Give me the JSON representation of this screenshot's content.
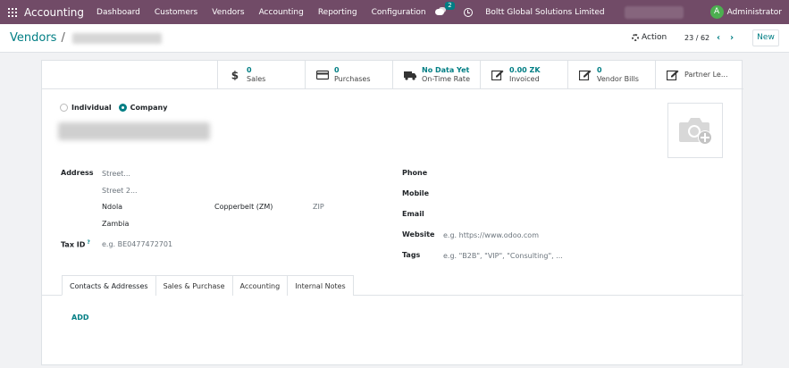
{
  "navbar": {
    "app_name": "Accounting",
    "menu": [
      "Dashboard",
      "Customers",
      "Vendors",
      "Accounting",
      "Reporting",
      "Configuration"
    ],
    "chat_count": "2",
    "company": "Boltt Global Solutions Limited",
    "avatar_letter": "A",
    "user": "Administrator"
  },
  "control": {
    "breadcrumb_parent": "Vendors",
    "breadcrumb_sep": "/",
    "action_label": "Action",
    "pager": "23 / 62",
    "new_label": "New"
  },
  "stats": [
    {
      "value": "0",
      "label": "Sales",
      "icon": "dollar-icon"
    },
    {
      "value": "0",
      "label": "Purchases",
      "icon": "credit-card-icon"
    },
    {
      "value": "No Data Yet",
      "label": "On-Time Rate",
      "icon": "truck-icon"
    },
    {
      "value": "0.00 ZK",
      "label": "Invoiced",
      "icon": "edit-icon"
    },
    {
      "value": "0",
      "label": "Vendor Bills",
      "icon": "edit-icon"
    },
    {
      "value": "",
      "label": "Partner Le...",
      "icon": "edit-icon"
    }
  ],
  "company_type": {
    "individual": "Individual",
    "company": "Company",
    "selected": "Company"
  },
  "fields": {
    "address_label": "Address",
    "street_placeholder": "Street...",
    "street2_placeholder": "Street 2...",
    "city": "Ndola",
    "state": "Copperbelt (ZM)",
    "zip_placeholder": "ZIP",
    "country": "Zambia",
    "tax_label": "Tax ID",
    "tax_help": "?",
    "tax_placeholder": "e.g. BE0477472701",
    "phone_label": "Phone",
    "mobile_label": "Mobile",
    "email_label": "Email",
    "website_label": "Website",
    "website_placeholder": "e.g. https://www.odoo.com",
    "tags_label": "Tags",
    "tags_placeholder": "e.g. \"B2B\", \"VIP\", \"Consulting\", ..."
  },
  "tabs": [
    "Contacts & Addresses",
    "Sales & Purchase",
    "Accounting",
    "Internal Notes"
  ],
  "active_tab": "Contacts & Addresses",
  "add_label": "ADD",
  "colors": {
    "brand": "#714b67",
    "accent": "#017e84"
  }
}
